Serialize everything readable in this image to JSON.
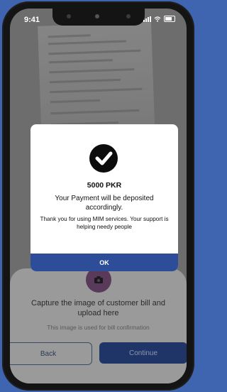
{
  "status_bar": {
    "time": "9:41"
  },
  "modal": {
    "amount": "5000 PKR",
    "message": "Your Payment will be deposited accordingly.",
    "thanks": "Thank you for using MIM services. Your support is helping  needy people",
    "ok_label": "OK",
    "icon": "checkmark-circle-icon"
  },
  "sheet": {
    "capture_text": "Capture the image of customer bill and upload here",
    "sub_text": "This image is used for bill confirmation",
    "back_label": "Back",
    "continue_label": "Continue",
    "icon": "camera-icon"
  },
  "colors": {
    "background": "#3f64b0",
    "ok_button": "#2d4d99",
    "continue_button": "#1f3467"
  }
}
